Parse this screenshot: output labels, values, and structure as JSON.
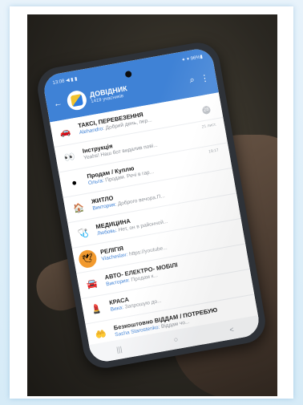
{
  "status": {
    "time": "13:08",
    "signal": "◀ ▮ ▮",
    "right": "✦ ▾ 96%▮"
  },
  "header": {
    "title": "ДОВІДНИК",
    "subtitle": "1419 учасників"
  },
  "chats": [
    {
      "title": "ТАКСІ, ПЕРЕВЕЗЕННЯ",
      "sender": "Alehandro:",
      "msg": "Добрий день, пер...",
      "time": "",
      "badge": "28",
      "icon": "🚗",
      "icon_bg": "#ffffff"
    },
    {
      "title": "Інструкція",
      "sender": "",
      "msg": "Yeahs! Наш бот видалив пові...",
      "time": "21 лист.",
      "badge": "",
      "icon": "👀",
      "icon_bg": "#ffffff"
    },
    {
      "title": "Продам / Куплю",
      "sender": "Ольга:",
      "msg": "Продам. Речі в гар...",
      "time": "19:17",
      "badge": "",
      "icon": "●",
      "icon_bg": "#ffffff"
    },
    {
      "title": "ЖИТЛО",
      "sender": "Виктория:",
      "msg": "Доброго вечора.П...",
      "time": "",
      "badge": "",
      "icon": "🏠",
      "icon_bg": "#ffffff"
    },
    {
      "title": "МЕДИЦИНА",
      "sender": "Любовь:",
      "msg": "Нет, он в районной...",
      "time": "",
      "badge": "",
      "icon": "🩺",
      "icon_bg": "#ffffff"
    },
    {
      "title": "РЕЛІГІЯ",
      "sender": "Viacheslav:",
      "msg": "https://youtube...",
      "time": "",
      "badge": "",
      "icon": "🕊",
      "icon_bg": "#f29a2e"
    },
    {
      "title": "АВТО- ЕЛЕКТРО- МОБІЛІ",
      "sender": "Виктория:",
      "msg": "Продам к...",
      "time": "",
      "badge": "",
      "icon": "🚘",
      "icon_bg": "#ffffff"
    },
    {
      "title": "КРАСА",
      "sender": "Вика:",
      "msg": "Запрошую до...",
      "time": "",
      "badge": "",
      "icon": "💄",
      "icon_bg": "#ffffff"
    },
    {
      "title": "Безкоштовно ВІДДАМ / ПОТРЕБУЮ",
      "sender": "Sasha Starostenko:",
      "msg": "Віддам чо...",
      "time": "",
      "badge": "",
      "icon": "🤲",
      "icon_bg": "#ffffff"
    }
  ],
  "navbar": {
    "recent": "|||",
    "home": "○",
    "back": "<"
  }
}
